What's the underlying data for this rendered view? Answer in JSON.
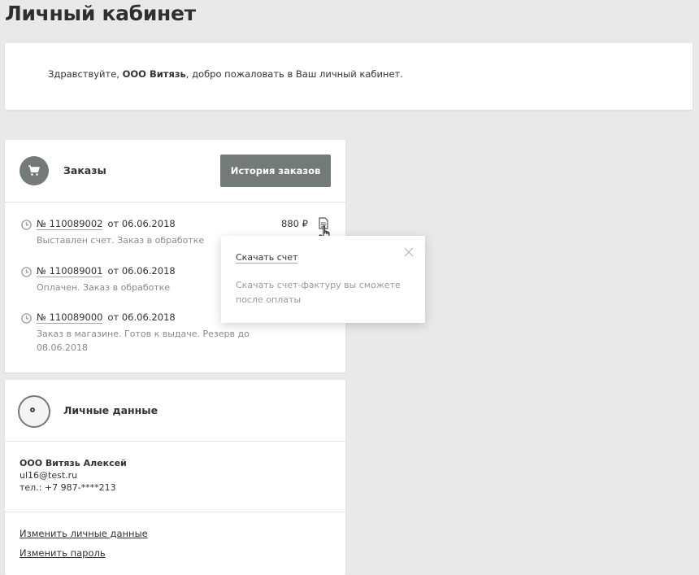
{
  "page": {
    "title": "Личный кабинет"
  },
  "greeting": {
    "prefix": "Здравствуйте, ",
    "company": "ООО Витязь",
    "suffix": ", добро пожаловать в Ваш личный кабинет."
  },
  "orders": {
    "title": "Заказы",
    "icon": "cart-icon",
    "history_button": "История заказов",
    "items": [
      {
        "number": "№ 110089002",
        "date": "от 06.06.2018",
        "status": "Выставлен счет. Заказ в обработке",
        "price": "880 ₽"
      },
      {
        "number": "№ 110089001",
        "date": "от 06.06.2018",
        "status": "Оплачен. Заказ в обработке"
      },
      {
        "number": "№ 110089000",
        "date": "от 06.06.2018",
        "status": "Заказ в магазине. Готов к выдаче. Резерв до 08.06.2018"
      }
    ]
  },
  "popover": {
    "link": "Скачать счет",
    "note": "Скачать счет-фактуру вы сможете после оплаты"
  },
  "personal": {
    "title": "Личные данные",
    "name": "ООО Витязь Алексей",
    "email": "ul16@test.ru",
    "phone": "тел.: +7 987-****213",
    "edit_link": "Изменить личные данные",
    "password_link": "Изменить пароль"
  },
  "colors": {
    "background": "#e9e9ea",
    "accent_gray": "#737a78",
    "muted_text": "#8a8a8a"
  }
}
